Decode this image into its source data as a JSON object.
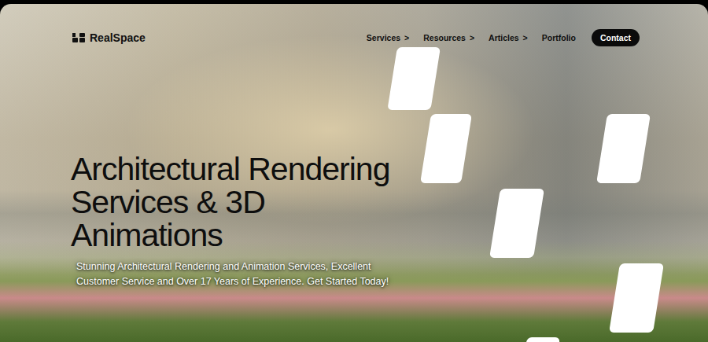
{
  "header": {
    "logo": "RealSpace",
    "nav": [
      {
        "label": "Services",
        "chevron": ">"
      },
      {
        "label": "Resources",
        "chevron": ">"
      },
      {
        "label": "Articles",
        "chevron": ">"
      },
      {
        "label": "Portfolio",
        "chevron": ""
      }
    ],
    "cta": "Contact"
  },
  "hero": {
    "title_lines": [
      "Architectural Rendering",
      "Services & 3D",
      "Animations"
    ],
    "subtitle_lines": [
      "Stunning Architectural Rendering and Animation Services, Excellent",
      "Customer Service and Over 17 Years of Experience. Get Started Today!"
    ]
  }
}
